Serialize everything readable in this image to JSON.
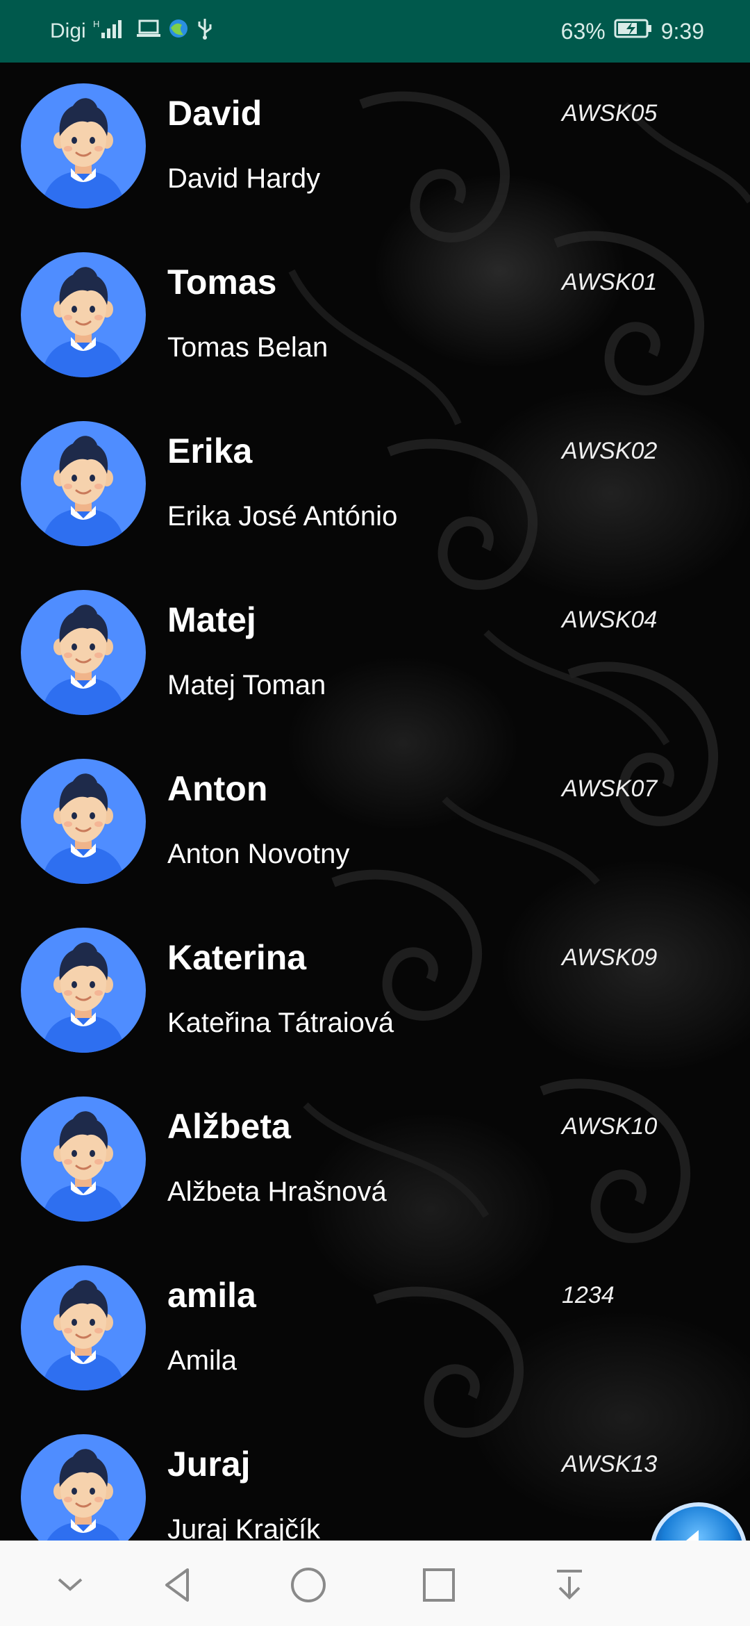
{
  "status_bar": {
    "carrier": "Digi",
    "battery": "63%",
    "time": "9:39",
    "icons": [
      "signal-icon",
      "laptop-icon",
      "browser-icon",
      "usb-icon",
      "battery-icon"
    ]
  },
  "contacts": [
    {
      "nick": "David",
      "full_name": "David Hardy",
      "code": "AWSK05"
    },
    {
      "nick": "Tomas",
      "full_name": "Tomas Belan",
      "code": "AWSK01"
    },
    {
      "nick": "Erika",
      "full_name": "Erika José António",
      "code": "AWSK02"
    },
    {
      "nick": "Matej",
      "full_name": "Matej Toman",
      "code": "AWSK04"
    },
    {
      "nick": "Anton",
      "full_name": "Anton Novotny",
      "code": "AWSK07"
    },
    {
      "nick": "Katerina",
      "full_name": "Kateřina Tátraiová",
      "code": "AWSK09"
    },
    {
      "nick": "Alžbeta",
      "full_name": "Alžbeta Hrašnová",
      "code": "AWSK10"
    },
    {
      "nick": "amila",
      "full_name": "Amila",
      "code": "1234"
    },
    {
      "nick": "Juraj",
      "full_name": "Juraj Krajčík",
      "code": "AWSK13"
    }
  ],
  "fab": {
    "icon": "back-arrow-icon"
  },
  "nav_bar": {
    "icons": [
      "collapse-icon",
      "back-icon",
      "home-icon",
      "recents-icon",
      "notifications-pull-icon"
    ]
  },
  "colors": {
    "status_bar": "#00594c",
    "avatar_bg": "#4f8dff",
    "fab": "#1a7fd8",
    "nav_bar": "#f9f9f9"
  }
}
